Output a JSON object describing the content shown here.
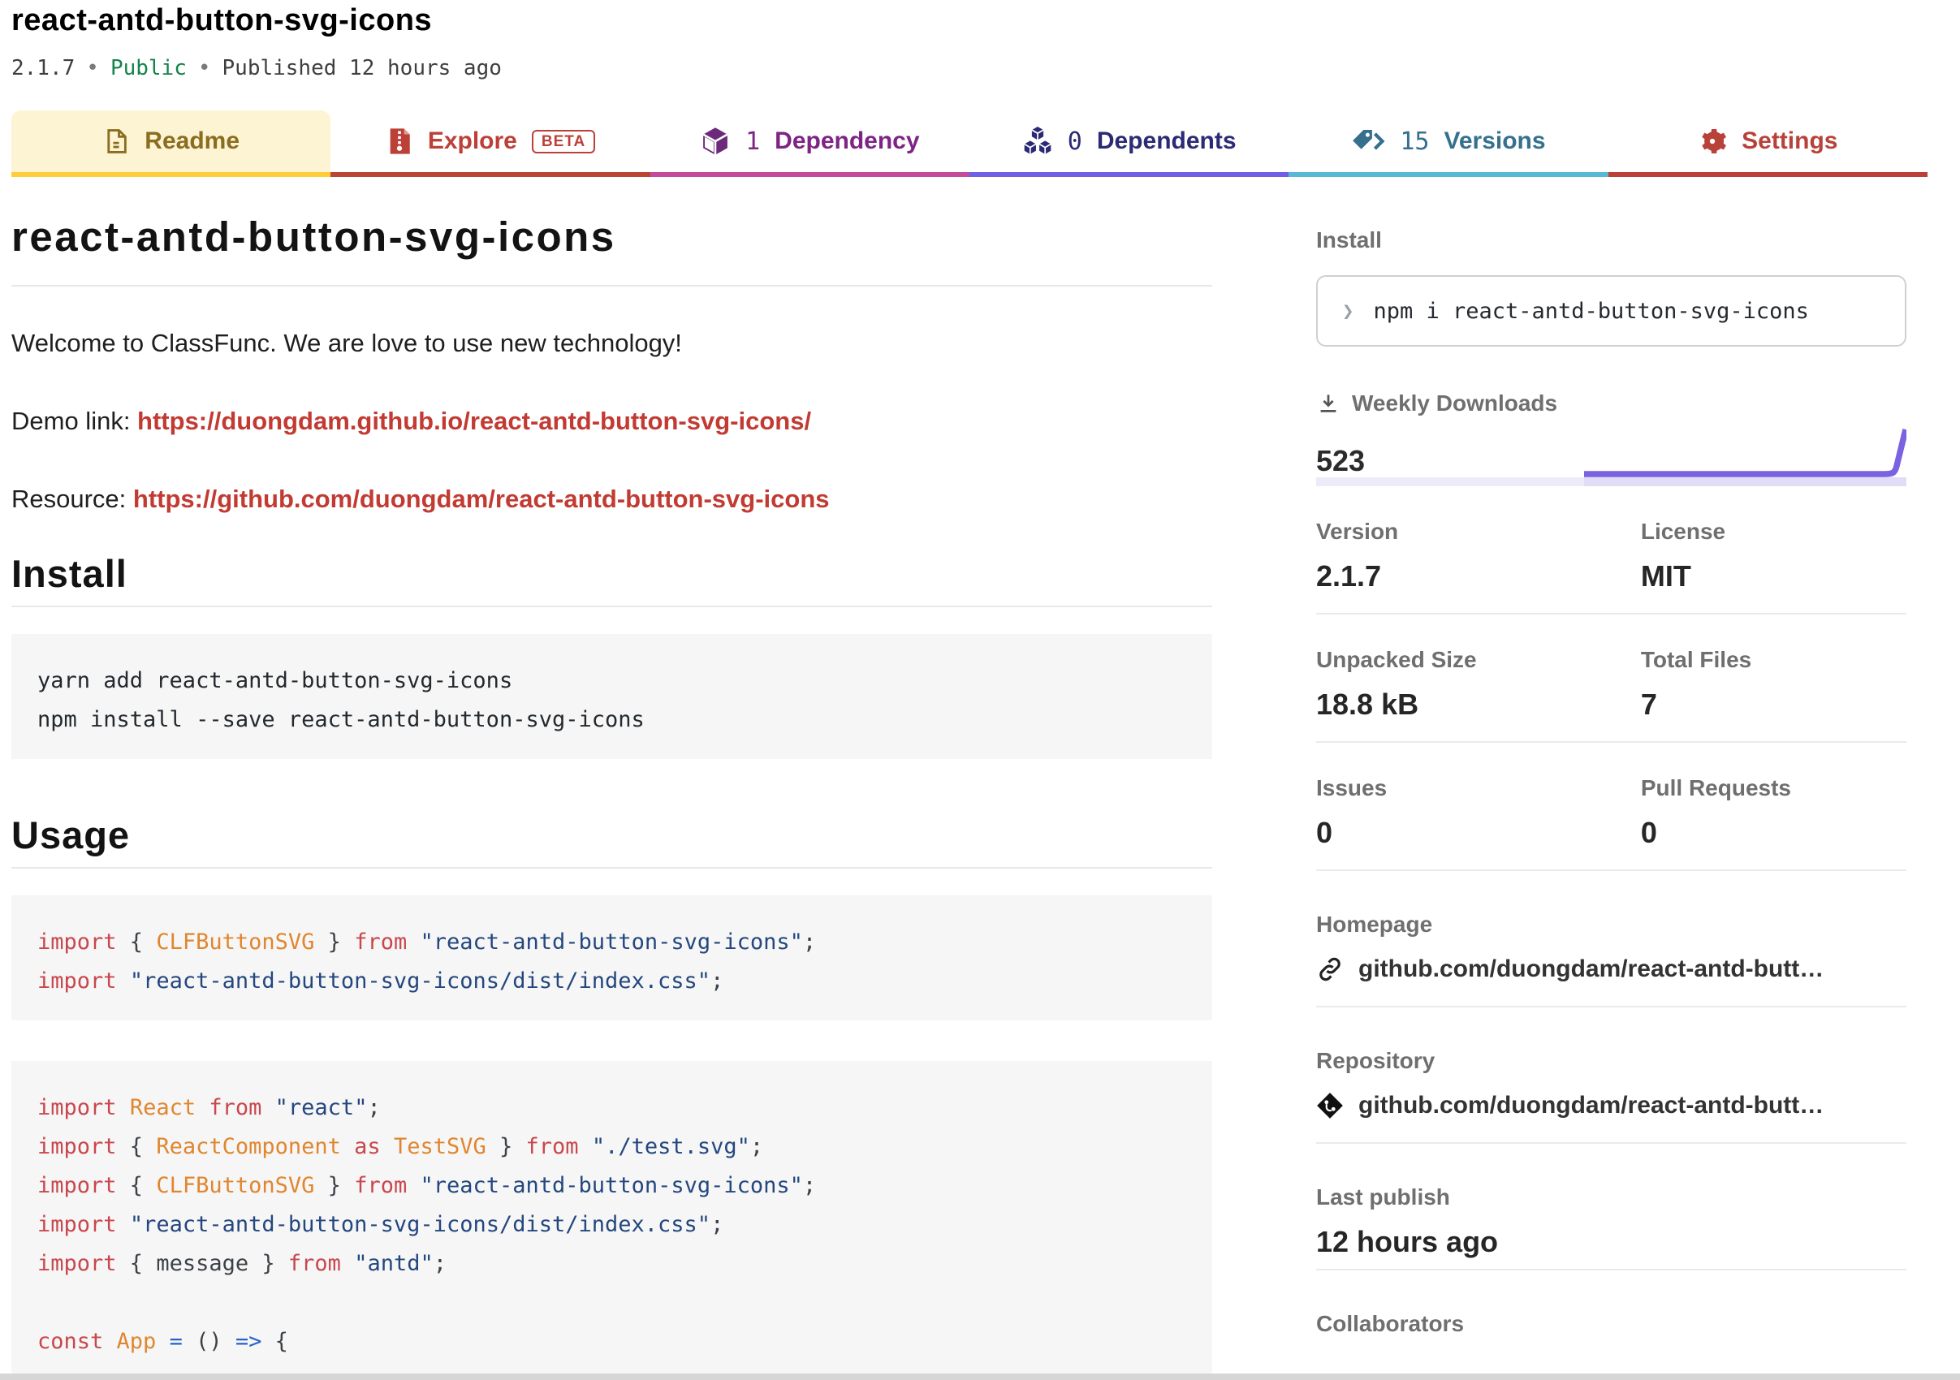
{
  "header": {
    "package_name": "react-antd-button-svg-icons",
    "version": "2.1.7",
    "visibility": "Public",
    "published": "Published 12 hours ago",
    "separator": "•"
  },
  "tabs": {
    "readme": {
      "label": "Readme"
    },
    "explore": {
      "label": "Explore",
      "badge": "BETA"
    },
    "dependency": {
      "count": "1",
      "label": "Dependency"
    },
    "dependents": {
      "count": "0",
      "label": "Dependents"
    },
    "versions": {
      "count": "15",
      "label": "Versions"
    },
    "settings": {
      "label": "Settings"
    }
  },
  "readme": {
    "title": "react-antd-button-svg-icons",
    "intro": "Welcome to ClassFunc. We are love to use new technology!",
    "demo_label": "Demo link: ",
    "demo_url": "https://duongdam.github.io/react-antd-button-svg-icons/",
    "resource_label": "Resource: ",
    "resource_url": "https://github.com/duongdam/react-antd-button-svg-icons",
    "install_heading": "Install",
    "install_code": [
      "yarn add react-antd-button-svg-icons",
      "npm install --save react-antd-button-svg-icons"
    ],
    "usage_heading": "Usage",
    "usage_code_1": [
      [
        {
          "c": "kw",
          "t": "import"
        },
        {
          "c": "pl",
          "t": " { "
        },
        {
          "c": "id",
          "t": "CLFButtonSVG"
        },
        {
          "c": "pl",
          "t": " } "
        },
        {
          "c": "kw",
          "t": "from"
        },
        {
          "c": "pl",
          "t": " "
        },
        {
          "c": "str",
          "t": "\"react-antd-button-svg-icons\""
        },
        {
          "c": "pl",
          "t": ";"
        }
      ],
      [
        {
          "c": "kw",
          "t": "import"
        },
        {
          "c": "pl",
          "t": " "
        },
        {
          "c": "str",
          "t": "\"react-antd-button-svg-icons/dist/index.css\""
        },
        {
          "c": "pl",
          "t": ";"
        }
      ]
    ],
    "usage_code_2": [
      [
        {
          "c": "kw",
          "t": "import"
        },
        {
          "c": "pl",
          "t": " "
        },
        {
          "c": "id",
          "t": "React"
        },
        {
          "c": "pl",
          "t": " "
        },
        {
          "c": "kw",
          "t": "from"
        },
        {
          "c": "pl",
          "t": " "
        },
        {
          "c": "str",
          "t": "\"react\""
        },
        {
          "c": "pl",
          "t": ";"
        }
      ],
      [
        {
          "c": "kw",
          "t": "import"
        },
        {
          "c": "pl",
          "t": " { "
        },
        {
          "c": "id",
          "t": "ReactComponent"
        },
        {
          "c": "pl",
          "t": " "
        },
        {
          "c": "kw",
          "t": "as"
        },
        {
          "c": "pl",
          "t": " "
        },
        {
          "c": "id",
          "t": "TestSVG"
        },
        {
          "c": "pl",
          "t": " } "
        },
        {
          "c": "kw",
          "t": "from"
        },
        {
          "c": "pl",
          "t": " "
        },
        {
          "c": "str",
          "t": "\"./test.svg\""
        },
        {
          "c": "pl",
          "t": ";"
        }
      ],
      [
        {
          "c": "kw",
          "t": "import"
        },
        {
          "c": "pl",
          "t": " { "
        },
        {
          "c": "id",
          "t": "CLFButtonSVG"
        },
        {
          "c": "pl",
          "t": " } "
        },
        {
          "c": "kw",
          "t": "from"
        },
        {
          "c": "pl",
          "t": " "
        },
        {
          "c": "str",
          "t": "\"react-antd-button-svg-icons\""
        },
        {
          "c": "pl",
          "t": ";"
        }
      ],
      [
        {
          "c": "kw",
          "t": "import"
        },
        {
          "c": "pl",
          "t": " "
        },
        {
          "c": "str",
          "t": "\"react-antd-button-svg-icons/dist/index.css\""
        },
        {
          "c": "pl",
          "t": ";"
        }
      ],
      [
        {
          "c": "kw",
          "t": "import"
        },
        {
          "c": "pl",
          "t": " { "
        },
        {
          "c": "pl",
          "t": "message"
        },
        {
          "c": "pl",
          "t": " } "
        },
        {
          "c": "kw",
          "t": "from"
        },
        {
          "c": "pl",
          "t": " "
        },
        {
          "c": "str",
          "t": "\"antd\""
        },
        {
          "c": "pl",
          "t": ";"
        }
      ],
      [],
      [
        {
          "c": "kw",
          "t": "const"
        },
        {
          "c": "pl",
          "t": " "
        },
        {
          "c": "id",
          "t": "App"
        },
        {
          "c": "pl",
          "t": " "
        },
        {
          "c": "op",
          "t": "="
        },
        {
          "c": "pl",
          "t": " () "
        },
        {
          "c": "op",
          "t": "=>"
        },
        {
          "c": "pl",
          "t": " {"
        }
      ]
    ]
  },
  "sidebar": {
    "install_label": "Install",
    "prompt": "❯",
    "install_command": "npm i react-antd-button-svg-icons",
    "weekly_downloads_label": "Weekly Downloads",
    "weekly_downloads_value": "523",
    "version_label": "Version",
    "version_value": "2.1.7",
    "license_label": "License",
    "license_value": "MIT",
    "unpacked_label": "Unpacked Size",
    "unpacked_value": "18.8 kB",
    "files_label": "Total Files",
    "files_value": "7",
    "issues_label": "Issues",
    "issues_value": "0",
    "prs_label": "Pull Requests",
    "prs_value": "0",
    "homepage_label": "Homepage",
    "homepage_link": "github.com/duongdam/react-antd-butt…",
    "repository_label": "Repository",
    "repository_link": "github.com/duongdam/react-antd-butt…",
    "last_publish_label": "Last publish",
    "last_publish_value": "12 hours ago",
    "collaborators_label": "Collaborators"
  }
}
